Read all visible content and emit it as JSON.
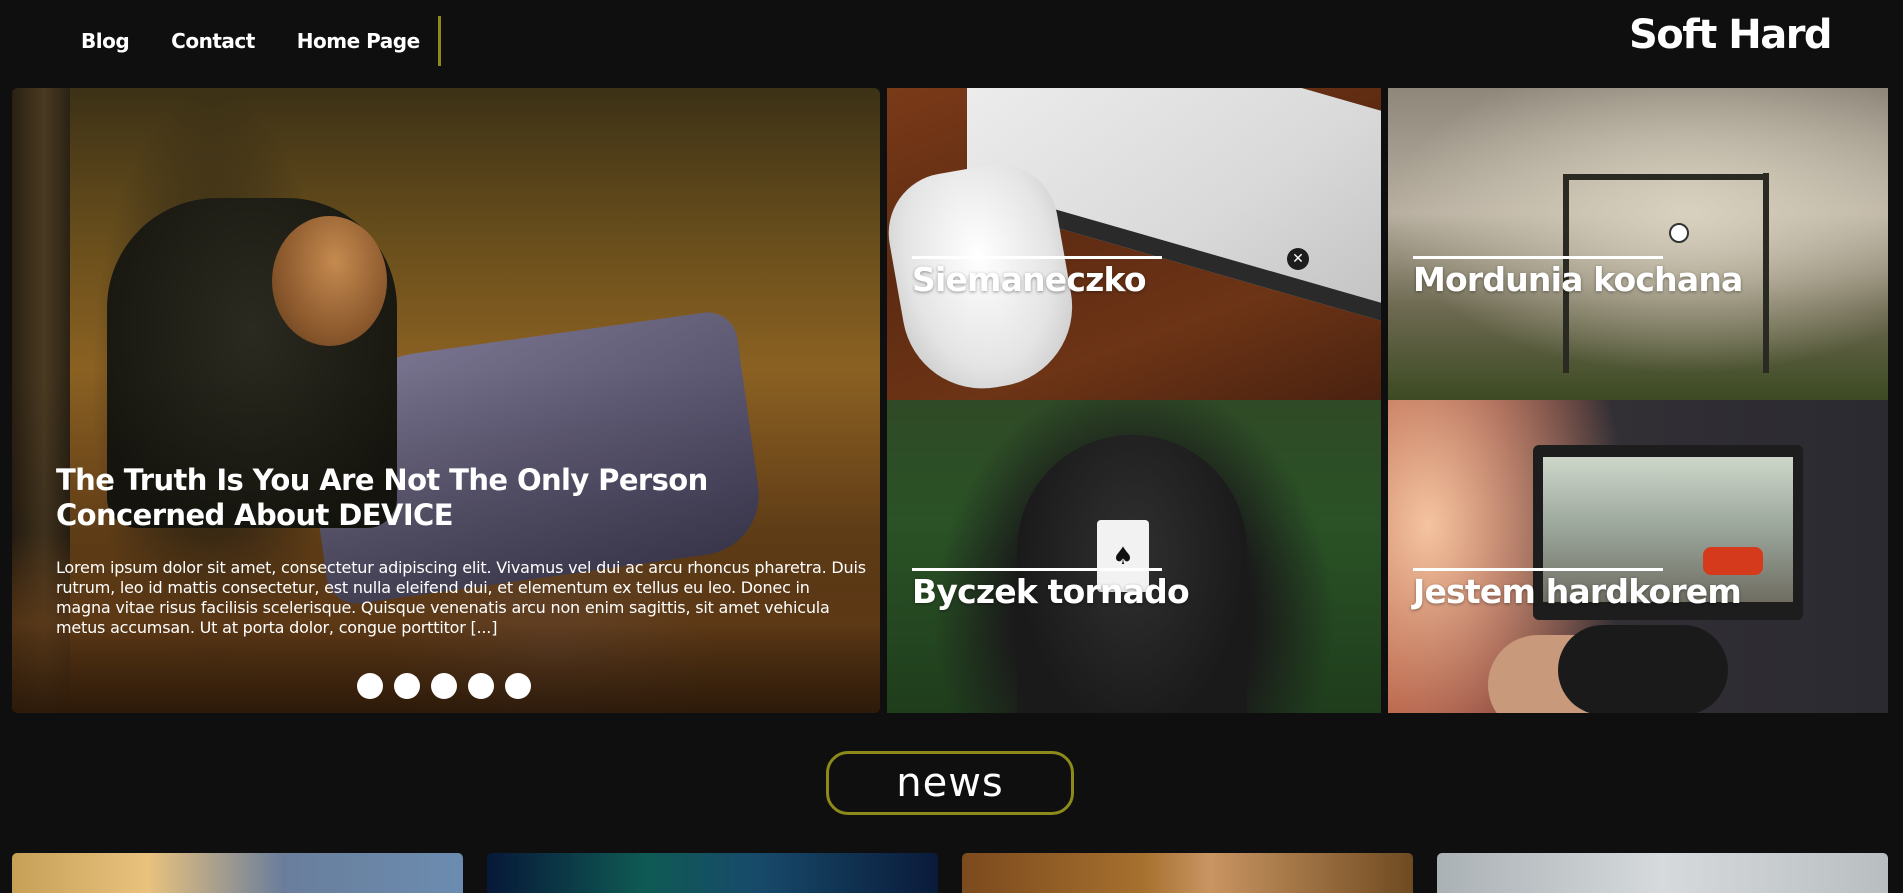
{
  "header": {
    "nav": [
      {
        "label": "Blog"
      },
      {
        "label": "Contact"
      },
      {
        "label": "Home Page"
      }
    ],
    "brand": "Soft Hard"
  },
  "hero": {
    "title": "The Truth Is You Are Not The Only Person Concerned About DEVICE",
    "excerpt": "Lorem ipsum dolor sit amet, consectetur adipiscing elit. Vivamus vel dui ac arcu rhoncus pharetra. Duis rutrum, leo id mattis consectetur, est nulla eleifend dui, et elementum ex tellus eu leo. Donec in magna vitae risus facilisis scelerisque. Quisque venenatis arcu non enim sagittis, sit amet vehicula metus accumsan. Ut at porta dolor, congue porttitor [...]",
    "slide_count": 5
  },
  "tiles": [
    {
      "title": "Siemaneczko"
    },
    {
      "title": "Mordunia kochana"
    },
    {
      "title": "Byczek tornado"
    },
    {
      "title": "Jestem hardkorem"
    }
  ],
  "news": {
    "heading": "news"
  },
  "colors": {
    "background": "#0f0f0f",
    "accent": "#8c8a1a",
    "text": "#ffffff"
  }
}
